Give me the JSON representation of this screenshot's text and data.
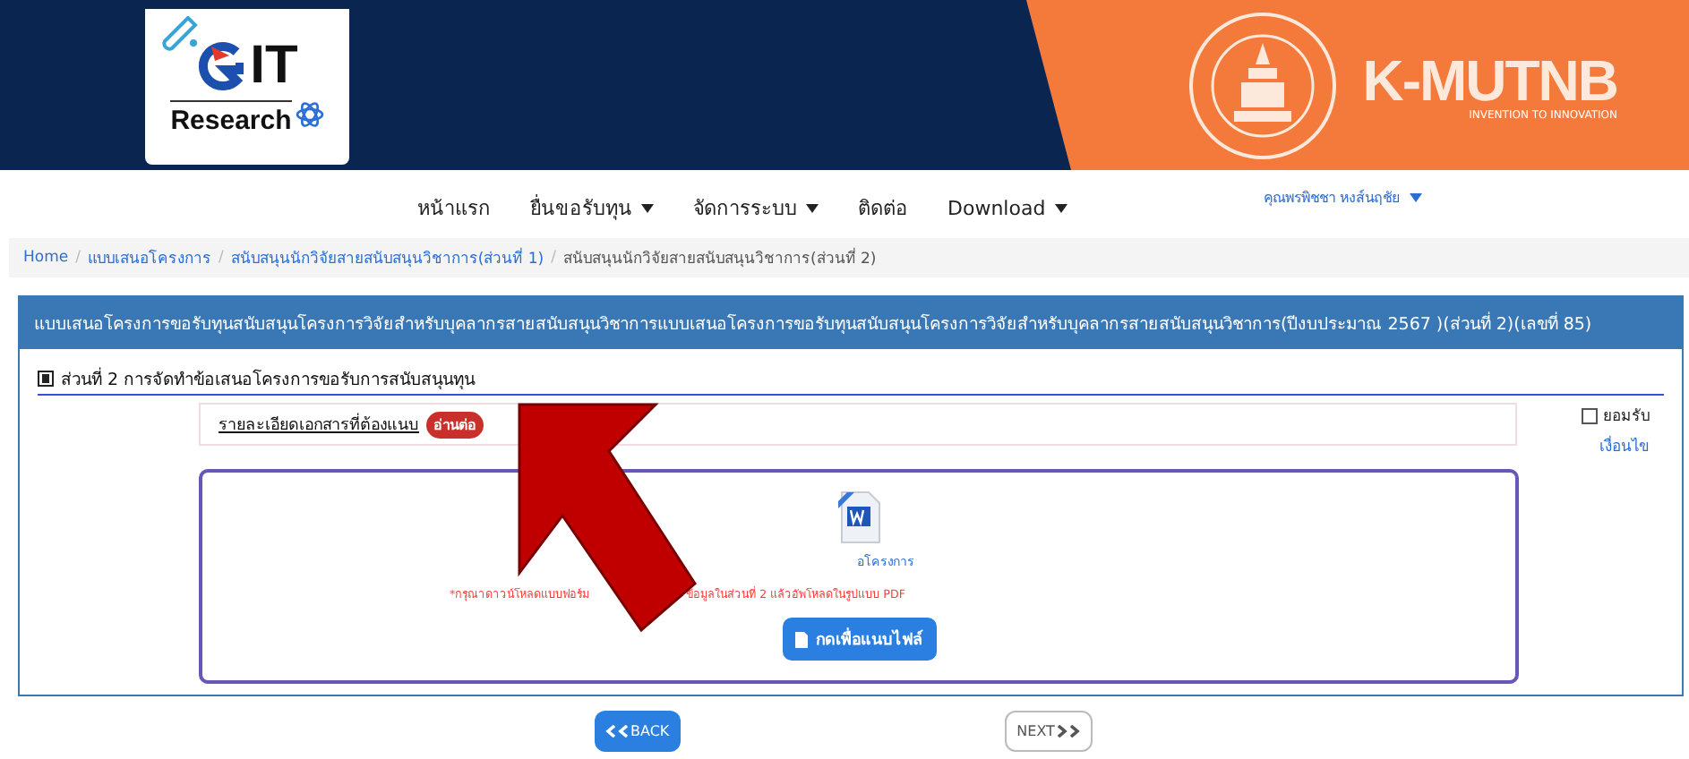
{
  "header": {
    "logo_title": "IT",
    "logo_subtitle": "Research",
    "brand": "K-MUTNB",
    "brand_tagline": "INVENTION TO INNOVATION"
  },
  "nav": {
    "items": [
      {
        "label": "หน้าแรก",
        "dropdown": false
      },
      {
        "label": "ยื่นขอรับทุน",
        "dropdown": true
      },
      {
        "label": "จัดการระบบ",
        "dropdown": true
      },
      {
        "label": "ติดต่อ",
        "dropdown": false
      },
      {
        "label": "Download",
        "dropdown": true
      }
    ],
    "user": "คุณพรพิชชา หงส์นฤชัย"
  },
  "breadcrumb": [
    {
      "label": "Home",
      "link": true
    },
    {
      "separator": "/",
      "label": "แบบเสนอโครงการ",
      "link": true
    },
    {
      "separator": "/",
      "label": "สนับสนุนนักวิจัยสายสนับสนุนวิชาการ(ส่วนที่ 1)",
      "link": true
    },
    {
      "separator": "/",
      "label": "สนับสนุนนักวิจัยสายสนับสนุนวิชาการ(ส่วนที่ 2)",
      "link": false
    }
  ],
  "panel": {
    "title": "แบบเสนอโครงการขอรับทุนสนับสนุนโครงการวิจัยสำหรับบุคลากรสายสนับสนุนวิชาการแบบเสนอโครงการขอรับทุนสนับสนุนโครงการวิจัยสำหรับบุคลากรสายสนับสนุนวิชาการ(ปีงบประมาณ 2567 )(ส่วนที่ 2)(เลขที่ 85)",
    "section_title": "ส่วนที่ 2 การจัดทำข้อเสนอโครงการขอรับการสนับสนุนทุน",
    "document_label": "รายละเอียดเอกสารที่ต้องแนบ",
    "read_more": "อ่านต่อ",
    "accept": {
      "label": "ยอมรับ",
      "checked": false
    },
    "terms_link": "เงื่อนไข",
    "upload": {
      "form_link": "อโครงการ",
      "note_left": "*กรุณาดาวน์โหลดแบบฟอร์ม",
      "note_right": "ข้อมูลในส่วนที่ 2 แล้วอัพโหลดในรูปแบบ PDF",
      "attach_button": "กดเพื่อแนบไฟล์"
    }
  },
  "buttons": {
    "back": "BACK",
    "next": "NEXT"
  }
}
